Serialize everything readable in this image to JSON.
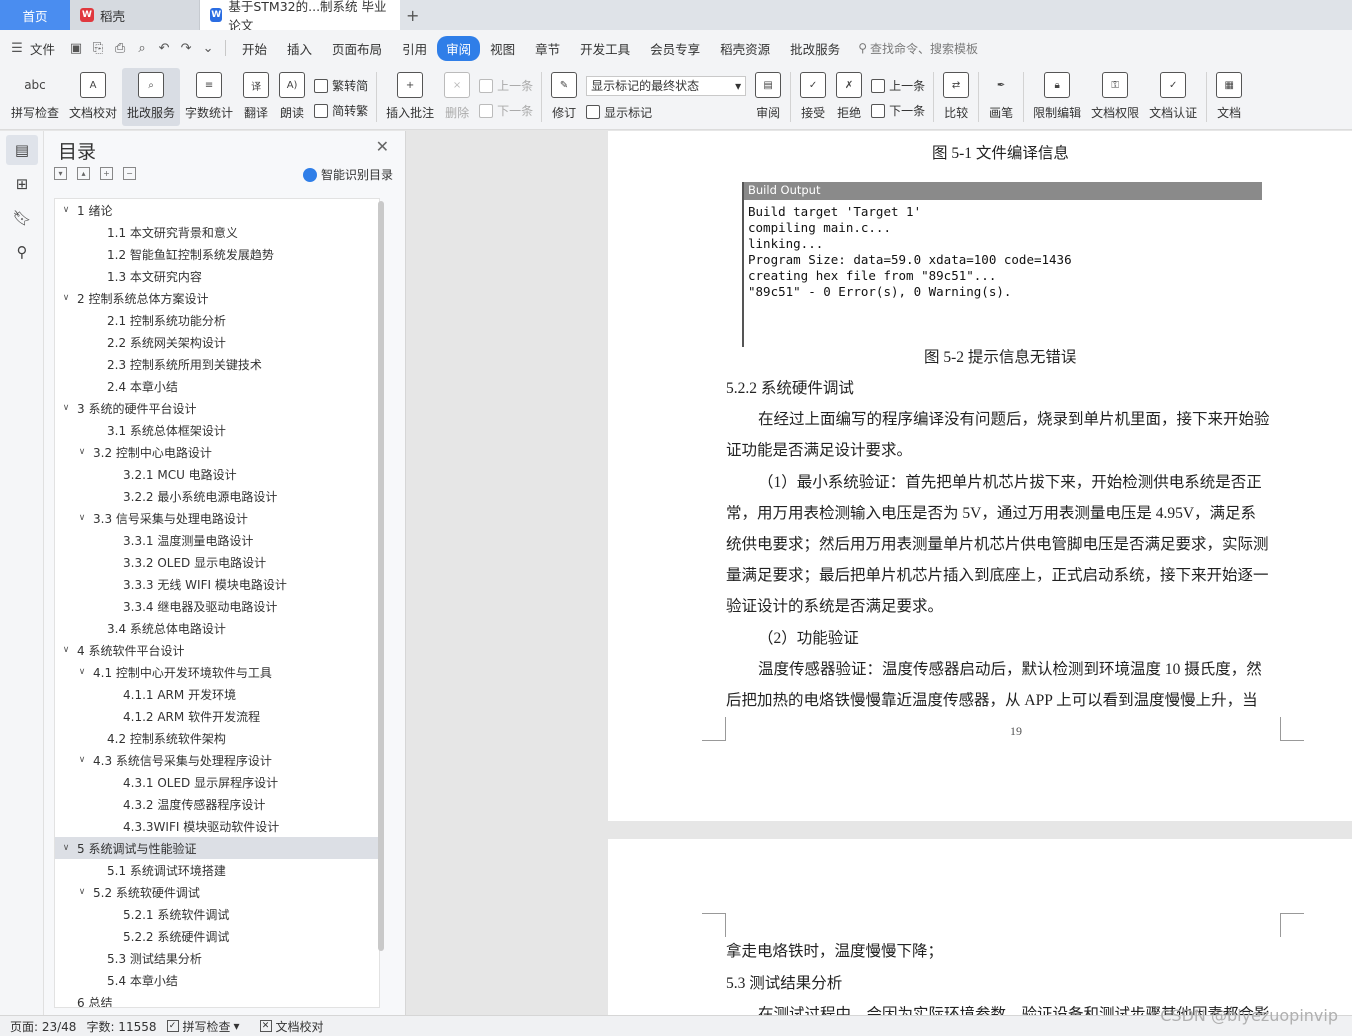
{
  "tabs": {
    "home": "首页",
    "daoke": "稻壳",
    "doc": "基于STM32的...制系统 毕业论文"
  },
  "menu": {
    "file": "文件",
    "items": [
      "开始",
      "插入",
      "页面布局",
      "引用",
      "审阅",
      "视图",
      "章节",
      "开发工具",
      "会员专享",
      "稻壳资源",
      "批改服务"
    ],
    "active": "审阅",
    "search": "查找命令、搜索模板"
  },
  "ribbon": {
    "spell_check": "拼写检查",
    "doc_check": "文档校对",
    "review_service": "批改服务",
    "word_count": "字数统计",
    "translate": "翻译",
    "read_aloud": "朗读",
    "trad": "繁转简",
    "simp": "简转繁",
    "insert_comment": "插入批注",
    "delete": "删除",
    "prev_comment": "上一条",
    "next_comment": "下一条",
    "revise": "修订",
    "display_select": "显示标记的最终状态",
    "show_marks": "显示标记",
    "review": "审阅",
    "accept": "接受",
    "reject": "拒绝",
    "prev": "上一条",
    "next": "下一条",
    "compare": "比较",
    "pen": "画笔",
    "restrict_edit": "限制编辑",
    "doc_permission": "文档权限",
    "doc_cert": "文档认证",
    "doc_more": "文档"
  },
  "outline": {
    "title": "目录",
    "smart": "智能识别目录",
    "items": [
      {
        "label": "1  绪论",
        "level": 1,
        "arrow": true
      },
      {
        "label": "1.1 本文研究背景和意义",
        "level": 2,
        "arrow": false
      },
      {
        "label": "1.2 智能鱼缸控制系统发展趋势",
        "level": 2,
        "arrow": false
      },
      {
        "label": "1.3 本文研究内容",
        "level": 2,
        "arrow": false
      },
      {
        "label": "2  控制系统总体方案设计",
        "level": 1,
        "arrow": true
      },
      {
        "label": "2.1 控制系统功能分析",
        "level": 2,
        "arrow": false
      },
      {
        "label": "2.2 系统网关架构设计",
        "level": 2,
        "arrow": false
      },
      {
        "label": "2.3 控制系统所用到关键技术",
        "level": 2,
        "arrow": false
      },
      {
        "label": "2.4 本章小结",
        "level": 2,
        "arrow": false
      },
      {
        "label": "3  系统的硬件平台设计",
        "level": 1,
        "arrow": true
      },
      {
        "label": "3.1 系统总体框架设计",
        "level": 2,
        "arrow": false
      },
      {
        "label": "3.2 控制中心电路设计",
        "level": 2,
        "arrow": true
      },
      {
        "label": "3.2.1 MCU 电路设计",
        "level": 3,
        "arrow": false
      },
      {
        "label": "3.2.2 最小系统电源电路设计",
        "level": 3,
        "arrow": false
      },
      {
        "label": "3.3 信号采集与处理电路设计",
        "level": 2,
        "arrow": true
      },
      {
        "label": "3.3.1 温度测量电路设计",
        "level": 3,
        "arrow": false
      },
      {
        "label": "3.3.2 OLED 显示电路设计",
        "level": 3,
        "arrow": false
      },
      {
        "label": "3.3.3 无线 WIFI 模块电路设计",
        "level": 3,
        "arrow": false
      },
      {
        "label": "3.3.4 继电器及驱动电路设计",
        "level": 3,
        "arrow": false
      },
      {
        "label": "3.4 系统总体电路设计",
        "level": 2,
        "arrow": false
      },
      {
        "label": "4  系统软件平台设计",
        "level": 1,
        "arrow": true
      },
      {
        "label": "4.1 控制中心开发环境软件与工具",
        "level": 2,
        "arrow": true
      },
      {
        "label": "4.1.1 ARM 开发环境",
        "level": 3,
        "arrow": false
      },
      {
        "label": "4.1.2 ARM 软件开发流程",
        "level": 3,
        "arrow": false
      },
      {
        "label": "4.2 控制系统软件架构",
        "level": 2,
        "arrow": false
      },
      {
        "label": "4.3 系统信号采集与处理程序设计",
        "level": 2,
        "arrow": true
      },
      {
        "label": "4.3.1 OLED 显示屏程序设计",
        "level": 3,
        "arrow": false
      },
      {
        "label": "4.3.2 温度传感器程序设计",
        "level": 3,
        "arrow": false
      },
      {
        "label": "4.3.3WIFI 模块驱动软件设计",
        "level": 3,
        "arrow": false
      },
      {
        "label": "5  系统调试与性能验证",
        "level": 1,
        "arrow": true,
        "selected": true
      },
      {
        "label": "5.1 系统调试环境搭建",
        "level": 2,
        "arrow": false
      },
      {
        "label": "5.2 系统软硬件调试",
        "level": 2,
        "arrow": true
      },
      {
        "label": "5.2.1 系统软件调试",
        "level": 3,
        "arrow": false
      },
      {
        "label": "5.2.2 系统硬件调试",
        "level": 3,
        "arrow": false
      },
      {
        "label": "5.3 测试结果分析",
        "level": 2,
        "arrow": false
      },
      {
        "label": "5.4 本章小结",
        "level": 2,
        "arrow": false
      },
      {
        "label": "6  总结",
        "level": 1,
        "arrow": false
      }
    ]
  },
  "document": {
    "fig51": "图 5-1 文件编译信息",
    "build_title": "Build Output",
    "build_lines": "Build target 'Target 1'\ncompiling main.c...\nlinking...\nProgram Size: data=59.0 xdata=100 code=1436\ncreating hex file from \"89c51\"...\n\"89c51\" - 0 Error(s), 0 Warning(s).",
    "fig52": "图 5-2 提示信息无错误",
    "h522": "5.2.2 系统硬件调试",
    "p1": "在经过上面编写的程序编译没有问题后，烧录到单片机里面，接下来开始验",
    "p1b": "证功能是否满足设计要求。",
    "p2": "（1）最小系统验证：首先把单片机芯片拔下来，开始检测供电系统是否正",
    "p2b": "常，用万用表检测输入电压是否为 5V，通过万用表测量电压是 4.95V，满足系",
    "p2c": "统供电要求；然后用万用表测量单片机芯片供电管脚电压是否满足要求，实际测",
    "p2d": "量满足要求；最后把单片机芯片插入到底座上，正式启动系统，接下来开始逐一",
    "p2e": "验证设计的系统是否满足要求。",
    "p3": "（2）功能验证",
    "p4": "温度传感器验证：温度传感器启动后，默认检测到环境温度 10 摄氏度，然",
    "p4b": "后把加热的电烙铁慢慢靠近温度传感器，从 APP 上可以看到温度慢慢上升，当",
    "page_num": "19",
    "p5": "拿走电烙铁时，温度慢慢下降；",
    "h53": "5.3 测试结果分析",
    "p6": "在测试过程中，会因为实际环境参数、验证设备和测试步骤其他因素都会影"
  },
  "status": {
    "page": "页面: 23/48",
    "words": "字数: 11558",
    "spell": "拼写检查",
    "doccheck": "文档校对"
  },
  "watermark": "CSDN @biyezuopinvip"
}
